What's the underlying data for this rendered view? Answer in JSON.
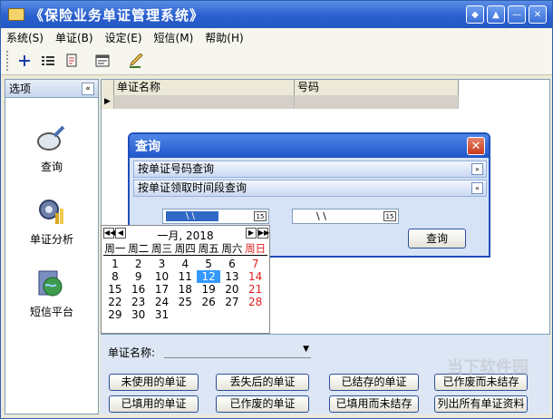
{
  "app": {
    "title": "《保险业务单证管理系统》"
  },
  "window_buttons": [
    "◆",
    "▲",
    "—",
    "✕"
  ],
  "menu": [
    "系统(S)",
    "单证(B)",
    "设定(E)",
    "短信(M)",
    "帮助(H)"
  ],
  "toolbar": {
    "icons": [
      "plus-icon",
      "list-icon",
      "document-icon",
      "form-icon",
      "pencil-icon"
    ]
  },
  "sidebar": {
    "title": "选项",
    "toggle": "«",
    "items": [
      {
        "label": "查询",
        "icon": "magnifier-icon"
      },
      {
        "label": "单证分析",
        "icon": "gear-chart-icon"
      },
      {
        "label": "短信平台",
        "icon": "globe-folder-icon"
      }
    ]
  },
  "grid": {
    "columns": [
      "单证名称",
      "号码"
    ],
    "row_marker": "▶"
  },
  "dialog": {
    "title": "查询",
    "close": "✕",
    "sections": [
      {
        "label": "按单证号码查询",
        "toggle": "»"
      },
      {
        "label": "按单证领取时间段查询",
        "toggle": "«"
      }
    ],
    "date_from": "\\  \\",
    "date_to": "\\  \\",
    "date_button": "15",
    "query_button": "查询"
  },
  "calendar": {
    "title": "一月, 2018",
    "nav_left": [
      "◀◀",
      "◀"
    ],
    "nav_right": [
      "▶",
      "▶▶"
    ],
    "weekdays": [
      "周一",
      "周二",
      "周三",
      "周四",
      "周五",
      "周六",
      "周日"
    ],
    "weeks": [
      [
        "1",
        "2",
        "3",
        "4",
        "5",
        "6",
        "7"
      ],
      [
        "8",
        "9",
        "10",
        "11",
        "12",
        "13",
        "14"
      ],
      [
        "15",
        "16",
        "17",
        "18",
        "19",
        "20",
        "21"
      ],
      [
        "22",
        "23",
        "24",
        "25",
        "26",
        "27",
        "28"
      ],
      [
        "29",
        "30",
        "31",
        "",
        "",
        "",
        ""
      ]
    ],
    "selected": "12"
  },
  "bottom": {
    "label": "单证名称:",
    "buttons_row1": [
      "未使用的单证",
      "丢失后的单证",
      "已结存的单证",
      "已作废而未结存"
    ],
    "buttons_row2": [
      "已填用的单证",
      "已作废的单证",
      "已填用而未结存",
      "列出所有单证资料"
    ]
  },
  "watermark": "当下软件园"
}
